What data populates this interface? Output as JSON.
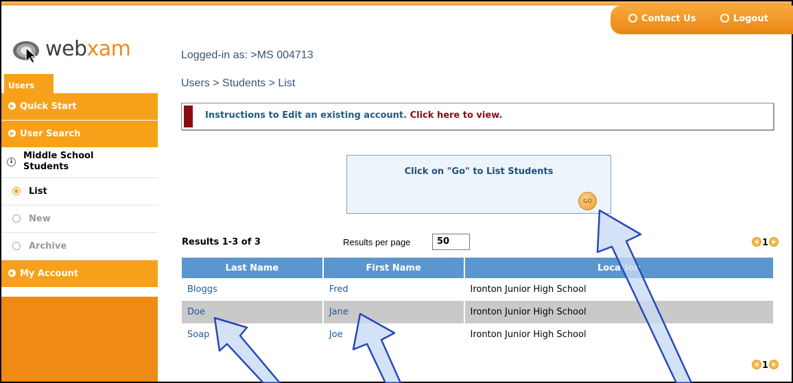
{
  "topnav": {
    "contact_label": "Contact Us",
    "logout_label": "Logout"
  },
  "logo": {
    "part1": "web",
    "part2": "xam"
  },
  "sidebar": {
    "tab_label": "Users",
    "quick_start": "Quick Start",
    "user_search": "User Search",
    "section_label_line1": "Middle School",
    "section_label_line2": "Students",
    "list_label": "List",
    "new_label": "New",
    "archive_label": "Archive",
    "my_account": "My Account"
  },
  "header": {
    "logged_in": "Logged-in as: >MS 004713",
    "breadcrumb": "Users > Students > List"
  },
  "instructions": {
    "text": "Instructions to Edit an existing account.",
    "link": "Click here to view."
  },
  "go_box": {
    "text": "Click on \"Go\" to List Students",
    "button_label": "GO"
  },
  "results": {
    "summary": "Results 1-3 of 3",
    "per_page_label": "Results per page",
    "per_page_value": "50",
    "page": "1"
  },
  "table": {
    "headers": [
      "Last Name",
      "First Name",
      "Location"
    ],
    "rows": [
      [
        "Bloggs",
        "Fred",
        "Ironton Junior High School"
      ],
      [
        "Doe",
        "Jane",
        "Ironton Junior High School"
      ],
      [
        "Soap",
        "Joe",
        "Ironton Junior High School"
      ]
    ]
  },
  "colors": {
    "accent_orange": "#f7a11a",
    "header_blue": "#5b97cf",
    "link_blue": "#1f5a9a",
    "marker_red": "#8b0c10"
  }
}
